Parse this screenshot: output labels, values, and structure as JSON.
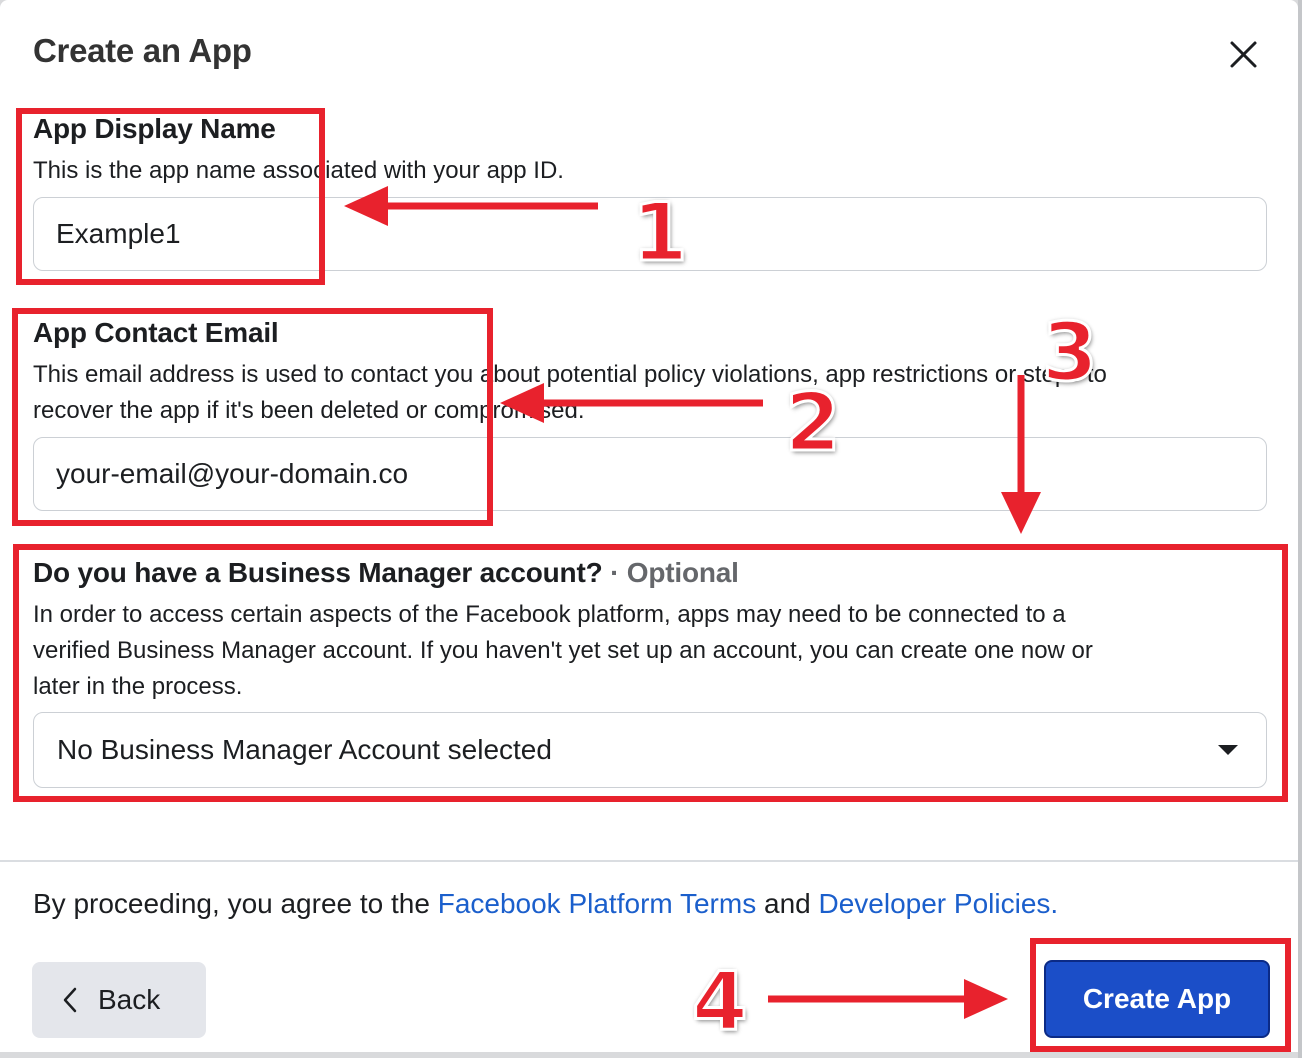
{
  "dialog": {
    "title": "Create an App",
    "close_icon": "close-icon"
  },
  "app_display_name": {
    "label": "App Display Name",
    "description": "This is the app name associated with your app ID.",
    "value": "Example1"
  },
  "app_contact_email": {
    "label": "App Contact Email",
    "description_line1": "This email address is used to contact you about potential policy violations, app restrictions or steps to",
    "description_line2": "recover the app if it's been deleted or compromised.",
    "value": "your-email@your-domain.co"
  },
  "business_manager": {
    "label": "Do you have a Business Manager account?",
    "optional": "· Optional",
    "description_line1": "In order to access certain aspects of the Facebook platform, apps may need to be connected to a",
    "description_line2": "verified Business Manager account. If you haven't yet set up an account, you can create one now or",
    "description_line3": "later in the process.",
    "selected": "No Business Manager Account selected"
  },
  "footer": {
    "terms_prefix": "By proceeding, you agree to the ",
    "terms_link": "Facebook Platform Terms",
    "terms_and": " and ",
    "policies_link": "Developer Policies.",
    "back_label": "Back",
    "create_label": "Create App"
  },
  "annotations": {
    "step1": "1",
    "step2": "2",
    "step3": "3",
    "step4": "4",
    "color": "#e8222d"
  }
}
